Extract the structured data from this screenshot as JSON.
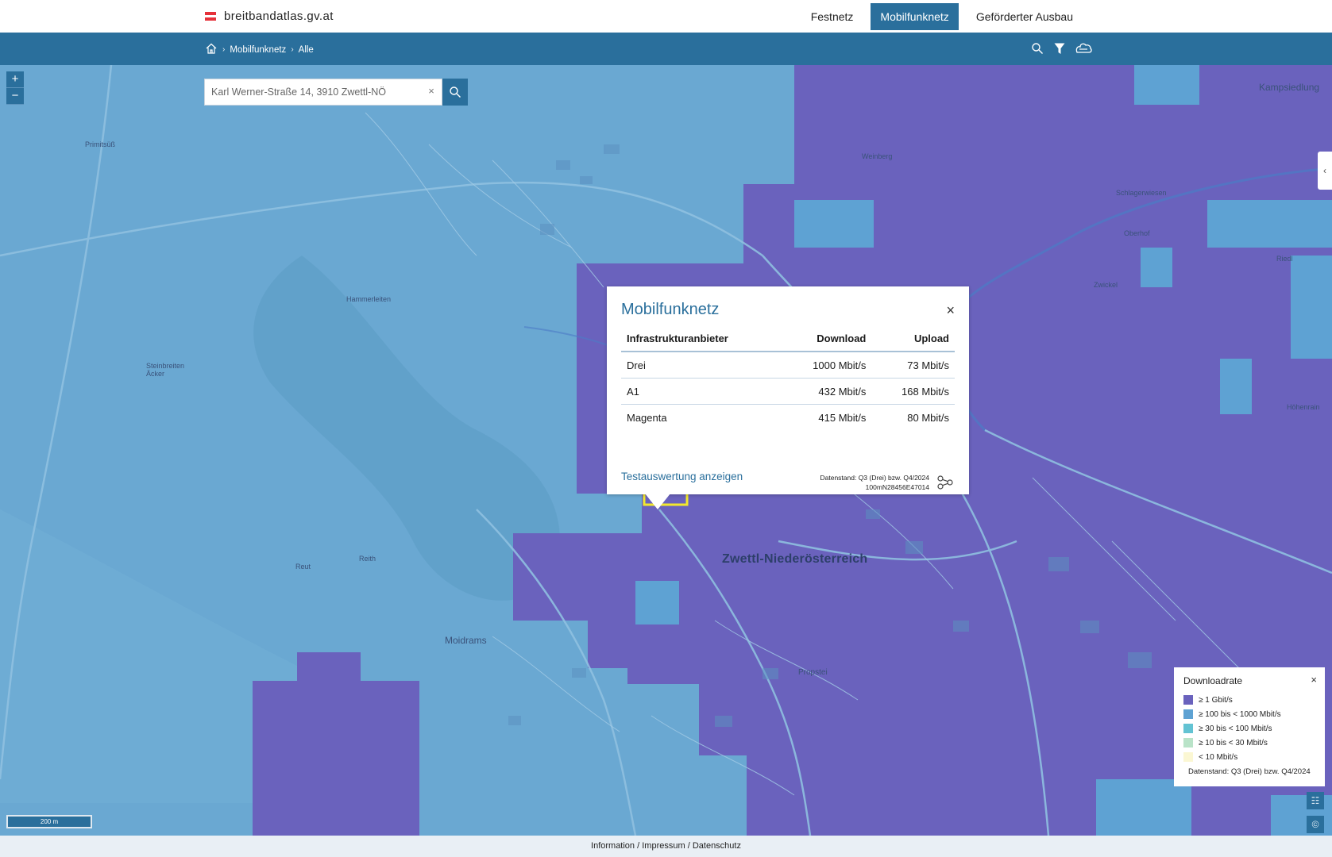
{
  "header": {
    "logo_text": "breitbandatlas.gv.at",
    "nav": [
      "Festnetz",
      "Mobilfunknetz",
      "Geförderter Ausbau"
    ]
  },
  "breadcrumb": {
    "level1": "Mobilfunknetz",
    "level2": "Alle"
  },
  "search": {
    "value": "Karl Werner-Straße 14, 3910 Zwettl-NÖ",
    "clear": "×"
  },
  "zoom": {
    "in": "+",
    "out": "−"
  },
  "map": {
    "town": "Zwettl-Niederösterreich",
    "places": [
      "Kampsiedlung",
      "Moidrams",
      "Reith",
      "Reut",
      "Propstei",
      "Primitsüß",
      "Hammerleiten",
      "Steinbreiten Äcker",
      "Weinberg",
      "Oberhof",
      "Zwickel",
      "Höhenrain",
      "Riedl",
      "Schlagerwiesen"
    ],
    "scale": "200 m"
  },
  "popup": {
    "title": "Mobilfunknetz",
    "close": "×",
    "columns": [
      "Infrastrukturanbieter",
      "Download",
      "Upload"
    ],
    "rows": [
      {
        "provider": "Drei",
        "download": "1000 Mbit/s",
        "upload": "73 Mbit/s"
      },
      {
        "provider": "A1",
        "download": "432 Mbit/s",
        "upload": "168 Mbit/s"
      },
      {
        "provider": "Magenta",
        "download": "415 Mbit/s",
        "upload": "80 Mbit/s"
      }
    ],
    "link": "Testauswertung anzeigen",
    "datenstand": "Datenstand: Q3 (Drei) bzw. Q4/2024",
    "cell_id": "100mN28456E47014"
  },
  "legend": {
    "title": "Downloadrate",
    "close": "×",
    "items": [
      {
        "label": "≥ 1 Gbit/s",
        "color": "#6a62bd"
      },
      {
        "label": "≥ 100 bis < 1000 Mbit/s",
        "color": "#5ea2d3"
      },
      {
        "label": "≥ 30 bis < 100 Mbit/s",
        "color": "#63c3d3"
      },
      {
        "label": "≥ 10 bis < 30 Mbit/s",
        "color": "#b9e3c8"
      },
      {
        "label": "< 10 Mbit/s",
        "color": "#fbf7d3"
      }
    ],
    "note": "Datenstand: Q3 (Drei) bzw. Q4/2024"
  },
  "footer": {
    "information": "Information",
    "impressum": "Impressum",
    "datenschutz": "Datenschutz",
    "sep": "/"
  },
  "side_handle": "‹",
  "right_tools": {
    "layers": "☷",
    "copyright": "©"
  },
  "colors": {
    "primary": "#2a6f9c",
    "coverage_high": "#6a62bd",
    "coverage_mid": "#5ea2d3"
  }
}
